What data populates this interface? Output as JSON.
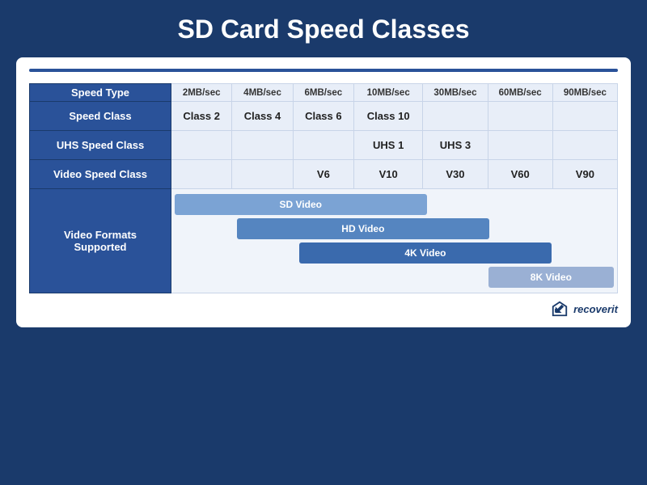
{
  "title": "SD Card Speed Classes",
  "table": {
    "speed_header": {
      "empty": "",
      "cols": [
        "2MB/sec",
        "4MB/sec",
        "6MB/sec",
        "10MB/sec",
        "30MB/sec",
        "60MB/sec",
        "90MB/sec"
      ]
    },
    "rows": [
      {
        "label": "Speed Type",
        "cells": [
          "2MB/sec",
          "4MB/sec",
          "6MB/sec",
          "10MB/sec",
          "30MB/sec",
          "60MB/sec",
          "90MB/sec"
        ]
      },
      {
        "label": "Speed Class",
        "cells": [
          "Class 2",
          "Class 4",
          "Class 6",
          "Class 10",
          "",
          "",
          ""
        ]
      },
      {
        "label": "UHS Speed Class",
        "cells": [
          "",
          "",
          "",
          "UHS 1",
          "UHS 3",
          "",
          ""
        ]
      },
      {
        "label": "Video Speed Class",
        "cells": [
          "",
          "",
          "V6",
          "V10",
          "V30",
          "V60",
          "V90"
        ]
      }
    ],
    "video_formats": {
      "label": "Video Formats\nSupported",
      "bars": [
        {
          "label": "SD Video",
          "class": "bar-sd",
          "colStart": 1,
          "colSpan": 4
        },
        {
          "label": "HD Video",
          "class": "bar-hd",
          "colStart": 2,
          "colSpan": 4
        },
        {
          "label": "4K Video",
          "class": "bar-4k",
          "colStart": 3,
          "colSpan": 4
        },
        {
          "label": "8K Video",
          "class": "bar-8k",
          "colStart": 6,
          "colSpan": 2
        }
      ]
    }
  },
  "branding": {
    "text": "recoverit"
  }
}
